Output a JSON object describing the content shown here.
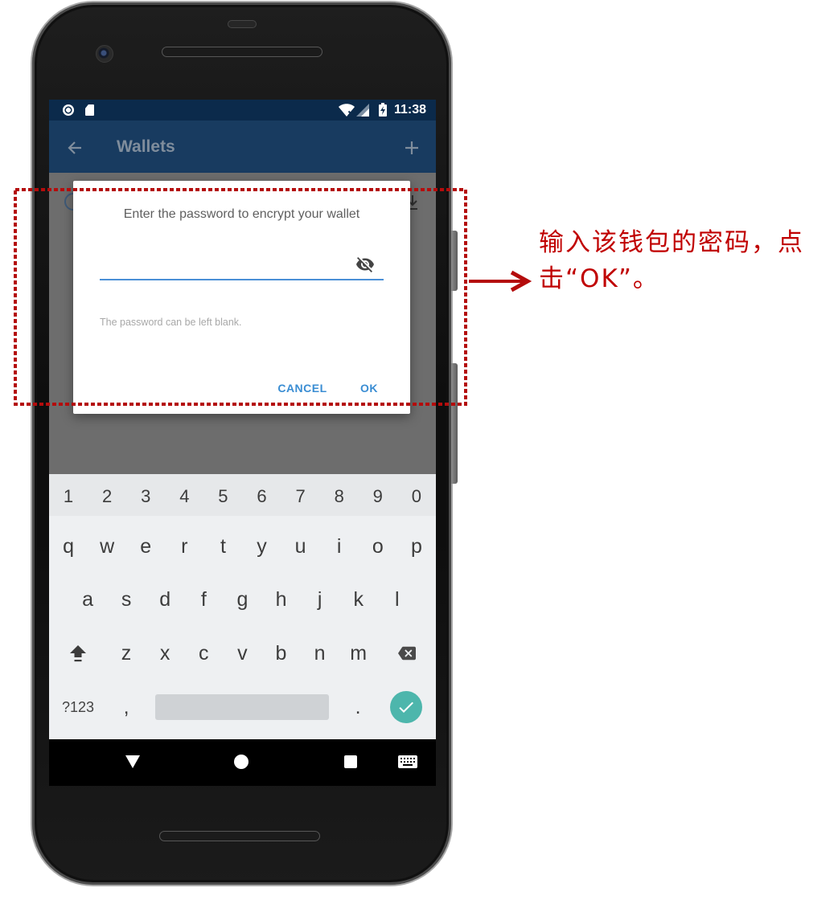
{
  "status_bar": {
    "time": "11:38",
    "left_icons": [
      "notification-circle-icon",
      "sd-card-icon"
    ],
    "right_icons": [
      "wifi-no-internet-icon",
      "cell-signal-icon",
      "battery-charging-icon"
    ]
  },
  "app_bar": {
    "title": "Wallets",
    "back_icon": "arrow-left-icon",
    "add_icon": "plus-icon"
  },
  "dialog": {
    "title": "Enter the password to encrypt your wallet",
    "password": {
      "value": "",
      "visibility_icon": "eye-off-icon"
    },
    "hint": "The password can be left blank.",
    "cancel_label": "CANCEL",
    "ok_label": "OK"
  },
  "keyboard": {
    "number_row": [
      "1",
      "2",
      "3",
      "4",
      "5",
      "6",
      "7",
      "8",
      "9",
      "0"
    ],
    "row1": [
      "q",
      "w",
      "e",
      "r",
      "t",
      "y",
      "u",
      "i",
      "o",
      "p"
    ],
    "row2": [
      "a",
      "s",
      "d",
      "f",
      "g",
      "h",
      "j",
      "k",
      "l"
    ],
    "row3": [
      "z",
      "x",
      "c",
      "v",
      "b",
      "n",
      "m"
    ],
    "symbols_label": "?123",
    "comma": ",",
    "period": ".",
    "shift_icon": "shift-arrow-icon",
    "backspace_icon": "backspace-icon",
    "enter_icon": "check-icon"
  },
  "nav_bar": {
    "icons": [
      "hide-keyboard-triangle-icon",
      "home-circle-icon",
      "recents-square-icon",
      "keyboard-switch-icon"
    ]
  },
  "annotation": {
    "lines": [
      "输入该钱包的密码，点",
      "击“OK”。"
    ]
  },
  "colors": {
    "status_bar": "#0b2a4b",
    "app_bar": "#183b60",
    "scrim": "#6d6d6d",
    "accent": "#3a8dd3",
    "enter_key": "#4db6ac",
    "annotation": "#c00000"
  }
}
